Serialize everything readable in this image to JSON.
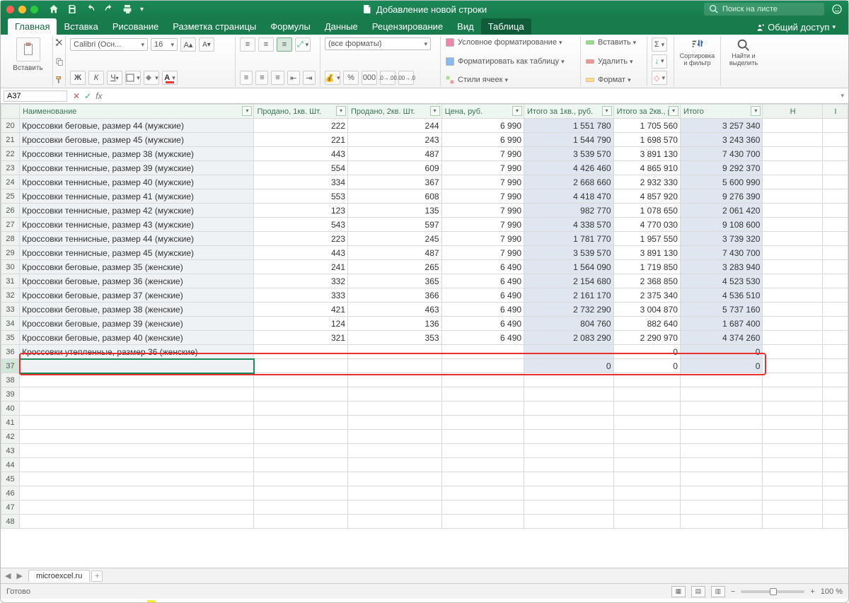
{
  "titlebar": {
    "title": "Добавление новой строки",
    "search_placeholder": "Поиск на листе"
  },
  "tabs": {
    "home": "Главная",
    "insert": "Вставка",
    "draw": "Рисование",
    "layout": "Разметка страницы",
    "formulas": "Формулы",
    "data": "Данные",
    "review": "Рецензирование",
    "view": "Вид",
    "table": "Таблица",
    "share": "Общий доступ"
  },
  "ribbon": {
    "paste": "Вставить",
    "font_name": "Calibri (Осн...",
    "font_size": "16",
    "format_dropdown": "(все форматы)",
    "cond_format": "Условное форматирование",
    "format_as_table": "Форматировать как таблицу",
    "cell_styles": "Стили ячеек",
    "insert_cell": "Вставить",
    "delete_cell": "Удалить",
    "format_cell": "Формат",
    "sort_filter": "Сортировка и фильтр",
    "find_select": "Найти и выделить",
    "bold": "Ж",
    "italic": "К",
    "underline": "Ч",
    "percent": "%",
    "thousands": "000"
  },
  "formula_bar": {
    "namebox": "A37"
  },
  "columns": {
    "name": "Наименование",
    "q1_qty": "Продано, 1кв. Шт.",
    "q2_qty": "Продано, 2кв. Шт.",
    "price": "Цена, руб.",
    "q1_total": "Итого за 1кв., руб.",
    "q2_total": "Итого за 2кв., р",
    "total": "Итого",
    "h": "H",
    "i": "I"
  },
  "rows": [
    {
      "n": 20,
      "name": "Кроссовки беговые, размер 44 (мужские)",
      "q1": "222",
      "q2": "244",
      "price": "6 990",
      "t1": "1 551 780",
      "t2": "1 705 560",
      "tot": "3 257 340"
    },
    {
      "n": 21,
      "name": "Кроссовки беговые, размер 45 (мужские)",
      "q1": "221",
      "q2": "243",
      "price": "6 990",
      "t1": "1 544 790",
      "t2": "1 698 570",
      "tot": "3 243 360"
    },
    {
      "n": 22,
      "name": "Кроссовки теннисные, размер 38 (мужские)",
      "q1": "443",
      "q2": "487",
      "price": "7 990",
      "t1": "3 539 570",
      "t2": "3 891 130",
      "tot": "7 430 700"
    },
    {
      "n": 23,
      "name": "Кроссовки теннисные, размер 39 (мужские)",
      "q1": "554",
      "q2": "609",
      "price": "7 990",
      "t1": "4 426 460",
      "t2": "4 865 910",
      "tot": "9 292 370"
    },
    {
      "n": 24,
      "name": "Кроссовки теннисные, размер 40 (мужские)",
      "q1": "334",
      "q2": "367",
      "price": "7 990",
      "t1": "2 668 660",
      "t2": "2 932 330",
      "tot": "5 600 990"
    },
    {
      "n": 25,
      "name": "Кроссовки теннисные, размер 41 (мужские)",
      "q1": "553",
      "q2": "608",
      "price": "7 990",
      "t1": "4 418 470",
      "t2": "4 857 920",
      "tot": "9 276 390"
    },
    {
      "n": 26,
      "name": "Кроссовки теннисные, размер 42 (мужские)",
      "q1": "123",
      "q2": "135",
      "price": "7 990",
      "t1": "982 770",
      "t2": "1 078 650",
      "tot": "2 061 420"
    },
    {
      "n": 27,
      "name": "Кроссовки теннисные, размер 43 (мужские)",
      "q1": "543",
      "q2": "597",
      "price": "7 990",
      "t1": "4 338 570",
      "t2": "4 770 030",
      "tot": "9 108 600"
    },
    {
      "n": 28,
      "name": "Кроссовки теннисные, размер 44 (мужские)",
      "q1": "223",
      "q2": "245",
      "price": "7 990",
      "t1": "1 781 770",
      "t2": "1 957 550",
      "tot": "3 739 320"
    },
    {
      "n": 29,
      "name": "Кроссовки теннисные, размер 45 (мужские)",
      "q1": "443",
      "q2": "487",
      "price": "7 990",
      "t1": "3 539 570",
      "t2": "3 891 130",
      "tot": "7 430 700"
    },
    {
      "n": 30,
      "name": "Кроссовки беговые, размер 35 (женские)",
      "q1": "241",
      "q2": "265",
      "price": "6 490",
      "t1": "1 564 090",
      "t2": "1 719 850",
      "tot": "3 283 940"
    },
    {
      "n": 31,
      "name": "Кроссовки беговые, размер 36 (женские)",
      "q1": "332",
      "q2": "365",
      "price": "6 490",
      "t1": "2 154 680",
      "t2": "2 368 850",
      "tot": "4 523 530"
    },
    {
      "n": 32,
      "name": "Кроссовки беговые, размер 37 (женские)",
      "q1": "333",
      "q2": "366",
      "price": "6 490",
      "t1": "2 161 170",
      "t2": "2 375 340",
      "tot": "4 536 510"
    },
    {
      "n": 33,
      "name": "Кроссовки беговые, размер 38 (женские)",
      "q1": "421",
      "q2": "463",
      "price": "6 490",
      "t1": "2 732 290",
      "t2": "3 004 870",
      "tot": "5 737 160"
    },
    {
      "n": 34,
      "name": "Кроссовки беговые, размер 39 (женские)",
      "q1": "124",
      "q2": "136",
      "price": "6 490",
      "t1": "804 760",
      "t2": "882 640",
      "tot": "1 687 400"
    },
    {
      "n": 35,
      "name": "Кроссовки беговые, размер 40 (женские)",
      "q1": "321",
      "q2": "353",
      "price": "6 490",
      "t1": "2 083 290",
      "t2": "2 290 970",
      "tot": "4 374 260"
    },
    {
      "n": 36,
      "name": "Кроссовки утепленные, размер 36 (женские)",
      "q1": "",
      "q2": "",
      "price": "",
      "t1": "",
      "t2": "0",
      "tot": "0"
    }
  ],
  "row37": {
    "t1": "0",
    "t2": "0",
    "tot": "0"
  },
  "empty_rows": [
    38,
    39,
    40,
    41,
    42,
    43,
    44,
    45,
    46,
    47,
    48
  ],
  "sheet": {
    "name": "microexcel.ru"
  },
  "status": {
    "ready": "Готово",
    "zoom": "100 %"
  }
}
